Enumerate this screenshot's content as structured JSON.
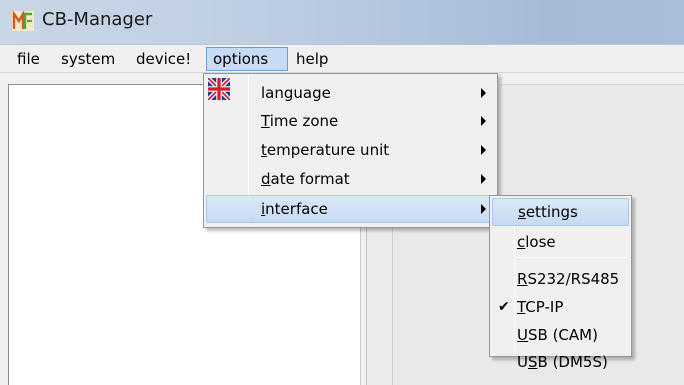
{
  "window": {
    "title": "CB-Manager",
    "icon": "cb-manager-app-icon"
  },
  "menubar": {
    "items": [
      {
        "label": "file"
      },
      {
        "label": "system"
      },
      {
        "label": "device!"
      },
      {
        "label": "options"
      },
      {
        "label": "help"
      }
    ],
    "open_menu": "options"
  },
  "options_menu": {
    "items": [
      {
        "label": "language",
        "icon": "uk-flag-icon",
        "submenu": true
      },
      {
        "label": "Time zone",
        "mnemonic": "T",
        "submenu": true
      },
      {
        "label": "temperature unit",
        "mnemonic": "t",
        "submenu": true
      },
      {
        "label": "date format",
        "mnemonic": "d",
        "submenu": true
      },
      {
        "label": "interface",
        "mnemonic": "i",
        "submenu": true,
        "highlighted": true
      }
    ]
  },
  "interface_menu": {
    "items": [
      {
        "label": "settings",
        "mnemonic": "s",
        "highlighted": true
      },
      {
        "label": "close",
        "mnemonic": "c"
      },
      {
        "label": "RS232/RS485",
        "mnemonic": "R"
      },
      {
        "label": "TCP-IP",
        "mnemonic": "T",
        "checked": true
      },
      {
        "label": "USB (CAM)",
        "mnemonic": "U"
      },
      {
        "label": "USB (DM5S)",
        "mnemonic": "S"
      }
    ]
  },
  "colors": {
    "highlight": "#c5daf3",
    "menubar_open": "#c7dcf4",
    "title_gradient_start": "#c8d6e6",
    "title_gradient_end": "#a9bfd9"
  }
}
